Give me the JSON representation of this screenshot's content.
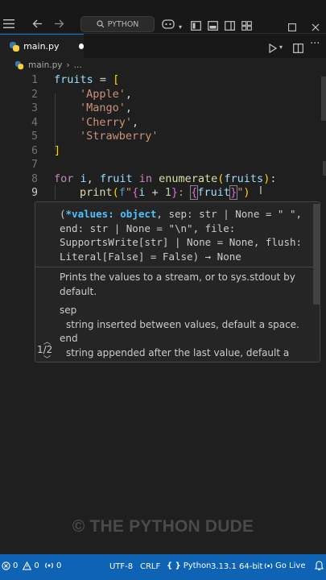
{
  "titlebar": {
    "search_label": "PYTHON",
    "window_controls": [
      "minimize",
      "restore",
      "close"
    ]
  },
  "tabs": [
    {
      "label": "main.py",
      "dirty": true
    }
  ],
  "breadcrumb": {
    "file": "main.py",
    "more": "..."
  },
  "editor": {
    "lines": [
      {
        "n": "1"
      },
      {
        "n": "2"
      },
      {
        "n": "3"
      },
      {
        "n": "4"
      },
      {
        "n": "5"
      },
      {
        "n": "6"
      },
      {
        "n": "7"
      },
      {
        "n": "8"
      },
      {
        "n": "9",
        "active": true
      }
    ],
    "code": {
      "l1_var": "fruits",
      "l1_rest": " = ",
      "l1_br": "[",
      "l2": "'Apple'",
      "l3": "'Mango'",
      "l4": "'Cherry'",
      "l5": "'Strawberry'",
      "comma": ",",
      "l6": "]",
      "l8_for": "for",
      "l8_i": "i",
      "l8_fruit": "fruit",
      "l8_in": "in",
      "l8_enum": "enumerate",
      "l8_arg": "fruits",
      "l9_print": "print",
      "l9_f": "f",
      "l9_q": "\"",
      "l9_i": "i",
      "l9_plus": " + ",
      "l9_one": "1",
      "l9_colon": ": ",
      "l9_fruit": "fruit"
    }
  },
  "signature_help": {
    "open_paren": "(",
    "active_param": "*values: object",
    "signature_rest": ", sep: str | None = \" \", end: str | None = \"\\n\", file: SupportsWrite[str] | None = None, flush: Literal[False] = False) → None",
    "description": "Prints the values to a stream, or to sys.stdout by default.",
    "params": [
      {
        "name": "sep",
        "desc": "string inserted between values, default a space."
      },
      {
        "name": "end",
        "desc": "string appended after the last value, default a newline."
      }
    ],
    "counter": "1/2"
  },
  "watermark": "© THE PYTHON DUDE",
  "statusbar": {
    "errors": "0",
    "warnings": "0",
    "ports": "0",
    "encoding": "UTF-8",
    "eol": "CRLF",
    "language": "Python",
    "interpreter": "3.13.1 64-bit",
    "golive": "Go Live"
  },
  "colors": {
    "accent": "#0e63b5",
    "keyword": "#c586c0",
    "function": "#dcdcaa",
    "variable": "#9cdcfe",
    "string": "#ce9178"
  }
}
